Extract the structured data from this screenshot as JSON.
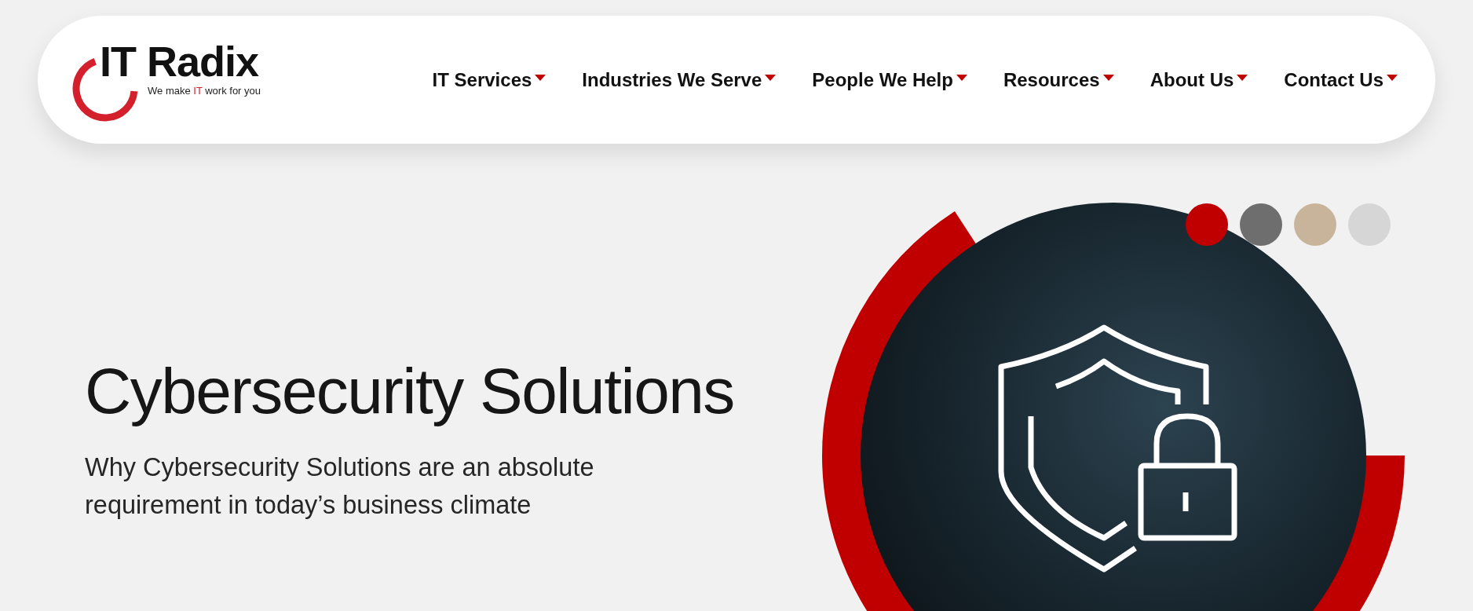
{
  "header": {
    "logo": {
      "name": "IT Radix",
      "tagline": {
        "before": "We make ",
        "highlight": "IT",
        "after": " work for you"
      }
    },
    "nav": [
      {
        "label": "IT Services"
      },
      {
        "label": "Industries We Serve"
      },
      {
        "label": "People We Help"
      },
      {
        "label": "Resources"
      },
      {
        "label": "About Us"
      },
      {
        "label": "Contact Us"
      }
    ]
  },
  "hero": {
    "title": "Cybersecurity Solutions",
    "subtitle": "Why Cybersecurity Solutions are an absolute requirement in today’s business climate",
    "slides": [
      {
        "color": "#c00000"
      },
      {
        "color": "#6e6e6e"
      },
      {
        "color": "#c8b49a"
      },
      {
        "color": "#d6d6d6"
      }
    ]
  }
}
